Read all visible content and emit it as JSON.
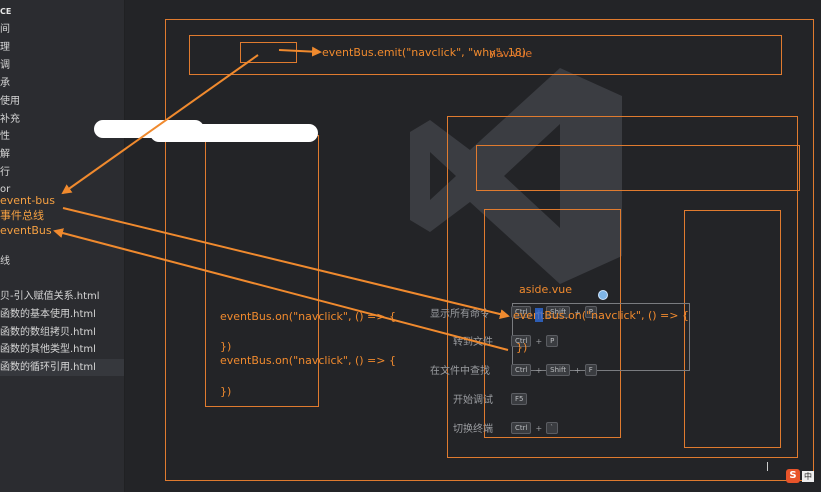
{
  "sidebar": {
    "header": "CE",
    "items": [
      "间",
      "理",
      "调",
      "承",
      "使用",
      "补充",
      "性",
      "解",
      "行",
      "or"
    ],
    "orange_items": [
      "event-bus",
      "事件总线",
      "eventBus"
    ],
    "extra_item": "线",
    "files": [
      "贝-引入赋值关系.html",
      "函数的基本使用.html",
      "函数的数组拷贝.html",
      "函数的其他类型.html",
      "函数的循环引用.html"
    ]
  },
  "diagram": {
    "emit_code": "eventBus.emit(\"navclick\", \"why\", 18)",
    "nav_label": "nav.vue",
    "on_code_1": "eventBus.on(\"navclick\", () => {",
    "close_1": "})",
    "on_code_2": "eventBus.on(\"navclick\", () => {",
    "close_2": "})",
    "aside_label": "aside.vue",
    "aside_code": "eventBus.on(\"navclick\", () => {",
    "aside_close": "})"
  },
  "vscode_commands": [
    {
      "label": "显示所有命令",
      "keys": [
        "Ctrl",
        "Shift",
        "P"
      ]
    },
    {
      "label": "转到文件",
      "keys": [
        "Ctrl",
        "P"
      ]
    },
    {
      "label": "在文件中查找",
      "keys": [
        "Ctrl",
        "Shift",
        "F"
      ]
    },
    {
      "label": "开始调试",
      "keys": [
        "F5"
      ]
    },
    {
      "label": "切换终端",
      "keys": [
        "Ctrl",
        "`"
      ]
    }
  ],
  "ime": {
    "logo": "S",
    "mode": "中"
  },
  "colors": {
    "accent": "#f08a2e",
    "box": "#e07b2f",
    "background": "#232427"
  }
}
